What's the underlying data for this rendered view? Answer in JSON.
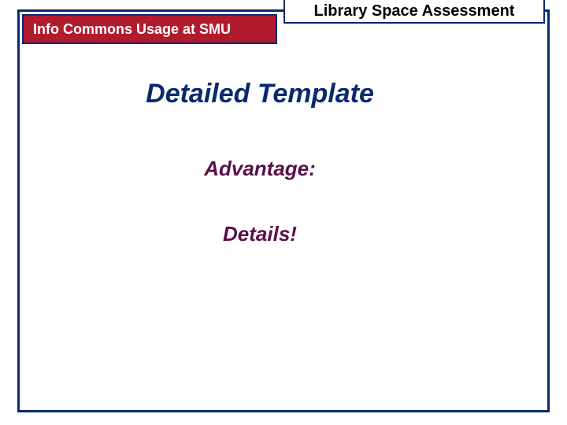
{
  "header": {
    "band_text": "Info Commons Usage at SMU",
    "title_bar": "Library Space Assessment"
  },
  "content": {
    "main_heading": "Detailed Template",
    "sub_heading_1": "Advantage:",
    "sub_heading_2": "Details!"
  }
}
